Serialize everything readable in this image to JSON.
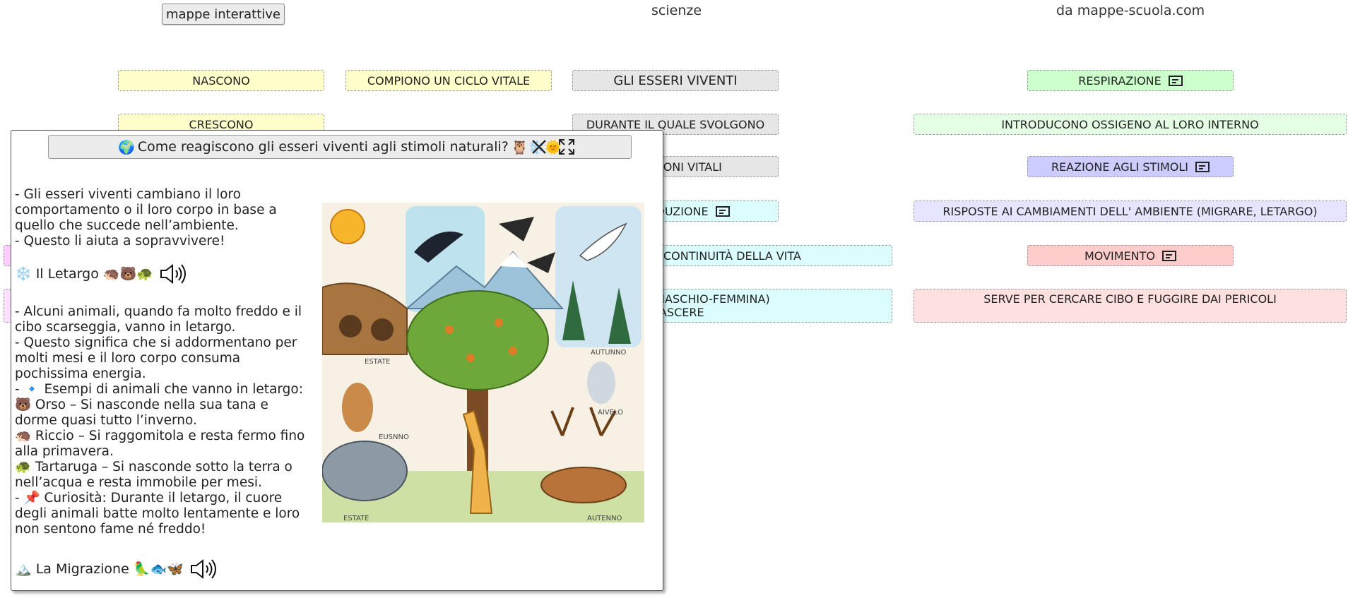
{
  "top": {
    "button_label": "mappe interattive",
    "subject": "scienze",
    "source": "da mappe-scuola.com"
  },
  "nodes": {
    "nascono": "NASCONO",
    "crescono": "CRESCONO",
    "compiono": "COMPIONO UN CICLO VITALE",
    "esseri_viventi": "GLI ESSERI VIVENTI",
    "durante": "DURANTE IL QUALE SVOLGONO",
    "funzioni_vitali": "FUNZIONI VITALI",
    "riproduzione": "RIPRODUZIONE",
    "continuita": "CONTINUITÀ DELLA VITA",
    "maschio_femmina_l1": "(MASCHIO-FEMMINA)",
    "maschio_femmina_l2": "NASCERE",
    "respirazione": "RESPIRAZIONE",
    "ossigeno": "INTRODUCONO OSSIGENO AL LORO INTERNO",
    "reazione": "REAZIONE AGLI STIMOLI",
    "risposte": "RISPOSTE AI CAMBIAMENTI DELL' AMBIENTE (MIGRARE, LETARGO)",
    "movimento": "MOVIMENTO",
    "cibo": "SERVE PER CERCARE CIBO E FUGGIRE DAI PERICOLI"
  },
  "popup": {
    "title_prefix": "🌍",
    "title": "Come reagiscono gli esseri viventi agli stimoli naturali?",
    "title_suffix": "🦉❄️🌞",
    "intro_1": "- Gli esseri viventi cambiano il loro comportamento o il loro corpo in base a quello che succede nell’ambiente.",
    "intro_2": "- Questo li aiuta a sopravvivere!",
    "letargo_title": "❄️ Il Letargo 🦔🐻🐢",
    "letargo_lines": [
      "- Alcuni animali, quando fa molto freddo e il cibo scarseggia, vanno in letargo.",
      "- Questo significa che si addormentano per molti mesi e il loro corpo consuma pochissima energia.",
      "- 🔹 Esempi di animali che vanno in letargo:",
      "🐻 Orso – Si nasconde nella sua tana e dorme quasi tutto l’inverno.",
      "🦔 Riccio – Si raggomitola e resta fermo fino alla primavera.",
      "🐢 Tartaruga – Si nasconde sotto la terra o nell’acqua e resta immobile per mesi.",
      "- 📌 Curiosità: Durante il letargo, il cuore degli animali batte molto lentamente e loro non sentono fame né freddo!"
    ],
    "migrazione_title": "🏔️ La Migrazione 🦜🐟🦋",
    "image_labels": [
      "ESTATE",
      "AUTUNNO",
      "ESTATE",
      "EUSNNO",
      "AIVELO",
      "ESTATE",
      "AUTENNO"
    ]
  }
}
